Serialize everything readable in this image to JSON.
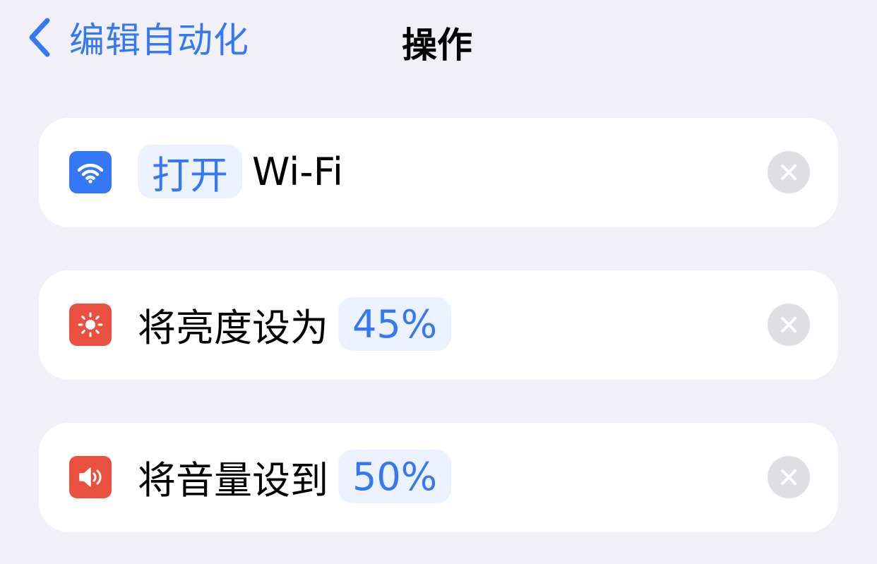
{
  "nav": {
    "back_label": "编辑自动化",
    "title": "操作"
  },
  "colors": {
    "accent": "#3478f6",
    "background": "#f0f0f6",
    "wifi_icon_bg": "#3478f6",
    "brightness_icon_bg": "#e9503f",
    "volume_icon_bg": "#e9503f",
    "pill_bg": "#ecf2fd",
    "remove_button_bg": "#dfdfe3"
  },
  "actions": [
    {
      "icon": "wifi-icon",
      "verb_pill": "打开",
      "text": "Wi-Fi"
    },
    {
      "icon": "brightness-icon",
      "text": "将亮度设为",
      "value_pill": "45%"
    },
    {
      "icon": "volume-icon",
      "text": "将音量设到",
      "value_pill": "50%"
    }
  ]
}
